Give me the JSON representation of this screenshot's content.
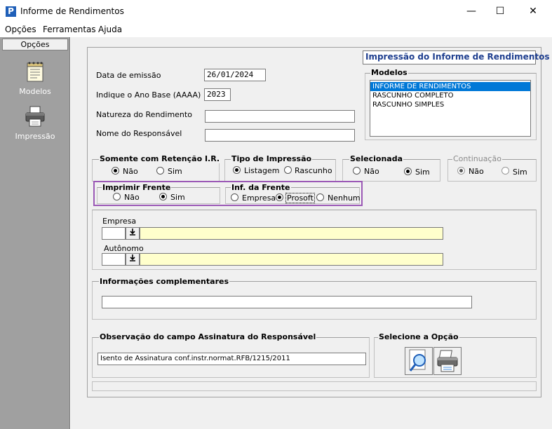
{
  "window": {
    "title": "Informe de Rendimentos",
    "app_icon": "P",
    "minimize": "—",
    "maximize": "☐",
    "close": "✕"
  },
  "menu": [
    "Opções",
    "Ferramentas",
    "Ajuda"
  ],
  "sidebar": {
    "header": "Opções",
    "items": [
      {
        "label": "Modelos",
        "icon": "notebook-icon"
      },
      {
        "label": "Impressão",
        "icon": "printer-icon"
      }
    ]
  },
  "panel": {
    "header": "Impressão do Informe de Rendimentos",
    "fields": {
      "data_emissao": {
        "label": "Data de emissão",
        "value": "26/01/2024"
      },
      "ano_base": {
        "label": "Indique o Ano Base (AAAA)",
        "value": "2023"
      },
      "natureza": {
        "label": "Natureza do Rendimento",
        "value": ""
      },
      "responsavel": {
        "label": "Nome do Responsável",
        "value": ""
      }
    },
    "modelos": {
      "title": "Modelos",
      "items": [
        "INFORME DE RENDIMENTOS",
        "RASCUNHO COMPLETO",
        "RASCUNHO SIMPLES"
      ],
      "selected": 0
    },
    "retencao": {
      "title": "Somente com Retenção I.R.",
      "options": [
        "Não",
        "Sim"
      ],
      "selected": 0
    },
    "tipo_impressao": {
      "title": "Tipo de Impressão",
      "options": [
        "Listagem",
        "Rascunho"
      ],
      "selected": 0
    },
    "selecionada": {
      "title": "Selecionada",
      "options": [
        "Não",
        "Sim"
      ],
      "selected": 1
    },
    "continuacao": {
      "title": "Continuação",
      "options": [
        "Não",
        "Sim"
      ],
      "selected": 0,
      "disabled": true
    },
    "imprimir_frente": {
      "title": "Imprimir Frente",
      "options": [
        "Não",
        "Sim"
      ],
      "selected": 1
    },
    "inf_frente": {
      "title": "Inf. da Frente",
      "options": [
        "Empresa",
        "Prosoft",
        "Nenhum"
      ],
      "selected": 1
    },
    "empresa": {
      "label": "Empresa",
      "code": "",
      "name": ""
    },
    "autonomo": {
      "label": "Autônomo",
      "code": "",
      "name": ""
    },
    "info_compl": {
      "title": "Informações complementares",
      "value": ""
    },
    "observacao": {
      "title": "Observação do campo Assinatura do Responsável",
      "value": "Isento de Assinatura conf.instr.normat.RFB/1215/2011"
    },
    "selecione": {
      "title": "Selecione a Opção"
    }
  },
  "colors": {
    "highlight_frame": "#9b59b6",
    "selection": "#0078d7",
    "lookup_field": "#ffffcc",
    "sidebar": "#a0a0a0"
  }
}
